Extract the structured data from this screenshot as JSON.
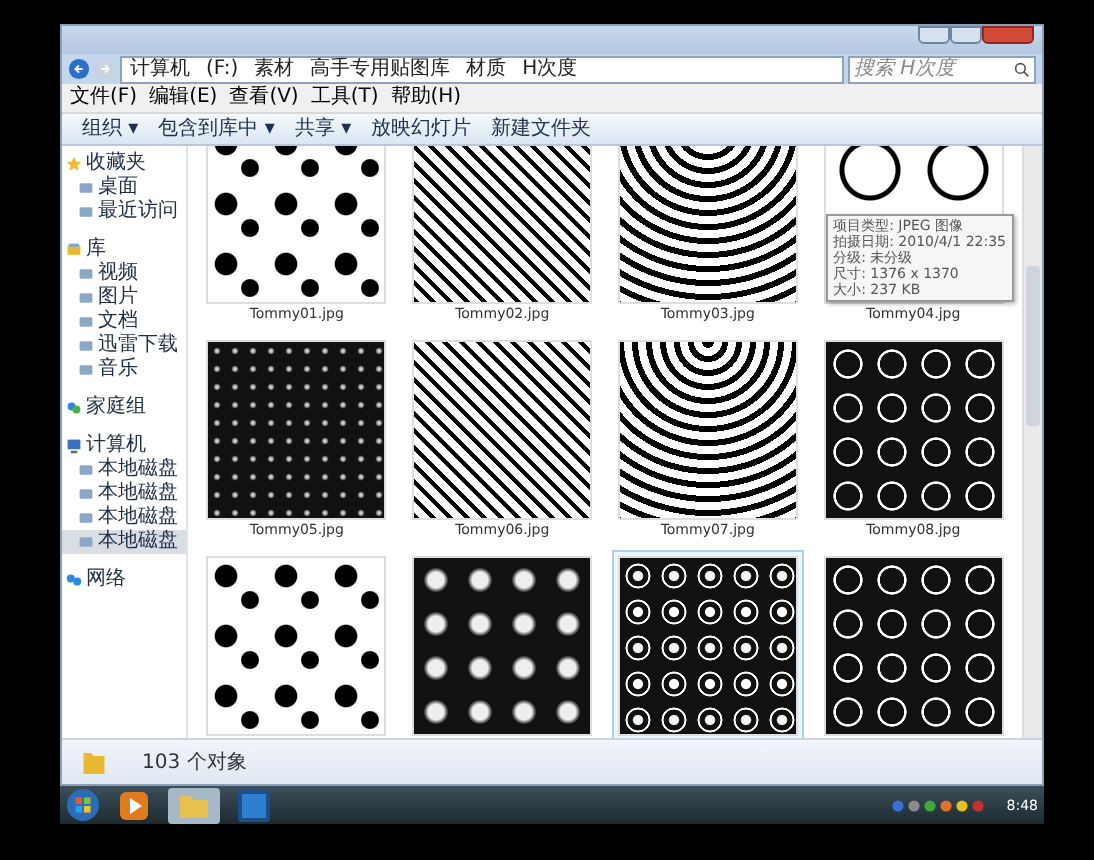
{
  "window": {
    "breadcrumb": [
      "计算机",
      "(F:)",
      "素材",
      "高手专用贴图库",
      "材质",
      "H次度"
    ],
    "search": {
      "placeholder": "搜索 H次度"
    }
  },
  "menu": [
    "文件(F)",
    "编辑(E)",
    "查看(V)",
    "工具(T)",
    "帮助(H)"
  ],
  "toolbar": [
    "组织 ▾",
    "包含到库中 ▾",
    "共享 ▾",
    "放映幻灯片",
    "新建文件夹"
  ],
  "sidebar": {
    "groups": [
      {
        "label": "收藏夹",
        "items": [
          {
            "label": "桌面",
            "selected": false
          },
          {
            "label": "最近访问",
            "selected": false
          }
        ]
      },
      {
        "label": "库",
        "items": [
          {
            "label": "视频",
            "selected": false
          },
          {
            "label": "图片",
            "selected": false
          },
          {
            "label": "文档",
            "selected": false
          },
          {
            "label": "迅雷下载",
            "selected": false
          },
          {
            "label": "音乐",
            "selected": false
          }
        ]
      },
      {
        "label": "家庭组"
      },
      {
        "label": "计算机",
        "items": [
          {
            "label": "本地磁盘",
            "selected": false
          },
          {
            "label": "本地磁盘",
            "selected": false
          },
          {
            "label": "本地磁盘",
            "selected": false
          },
          {
            "label": "本地磁盘",
            "selected": true
          }
        ]
      },
      {
        "label": "网络"
      }
    ]
  },
  "files": [
    {
      "name": "Tommy01.jpg",
      "selected": false
    },
    {
      "name": "Tommy02.jpg",
      "selected": false
    },
    {
      "name": "Tommy03.jpg",
      "selected": false
    },
    {
      "name": "Tommy04.jpg",
      "selected": false
    },
    {
      "name": "Tommy05.jpg",
      "selected": false
    },
    {
      "name": "Tommy06.jpg",
      "selected": false
    },
    {
      "name": "Tommy07.jpg",
      "selected": false
    },
    {
      "name": "Tommy08.jpg",
      "selected": false
    },
    {
      "selected": false
    },
    {
      "selected": false
    },
    {
      "selected": true
    },
    {
      "selected": false
    }
  ],
  "tooltip": [
    "项目类型: JPEG 图像",
    "拍摄日期: 2010/4/1 22:35",
    "分级: 未分级",
    "尺寸: 1376 x 1370",
    "大小: 237 KB"
  ],
  "status_bar": {
    "text": "103 个对象"
  },
  "taskbar": {
    "clock": "8:48"
  }
}
